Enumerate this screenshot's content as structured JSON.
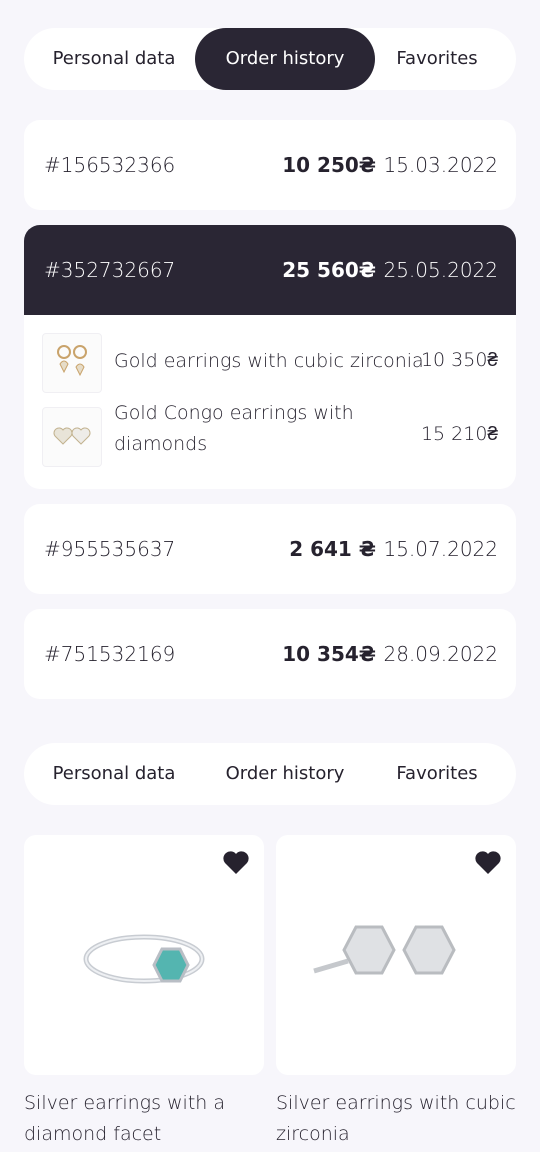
{
  "tabs_top": {
    "personal": "Personal data",
    "orders": "Order history",
    "favorites": "Favorites",
    "active": "orders"
  },
  "orders": [
    {
      "number": "#156532366",
      "sum": "10 250₴",
      "date": "15.03.2022"
    },
    {
      "number": "#352732667",
      "sum": "25 560₴",
      "date": "25.05.2022",
      "expanded": true,
      "items": [
        {
          "name": "Gold earrings with cubic zirconia",
          "price": "10 350₴"
        },
        {
          "name_line1": "Gold Congo earrings with",
          "name_line2": "diamonds",
          "price": "15 210₴"
        }
      ]
    },
    {
      "number": "#955535637",
      "sum": "2 641 ₴",
      "date": "15.07.2022"
    },
    {
      "number": "#751532169",
      "sum": "10 354₴",
      "date": "28.09.2022"
    }
  ],
  "tabs_bottom": {
    "personal": "Personal data",
    "orders": "Order history",
    "favorites": "Favorites"
  },
  "favorites": [
    {
      "name_line1": "Silver earrings with a",
      "name_line2": "diamond facet",
      "icon": "heart-icon"
    },
    {
      "name_line1": "Silver earrings with cubic",
      "name_line2": "zirconia",
      "icon": "heart-icon"
    }
  ],
  "colors": {
    "dark": "#2a2634",
    "bg": "#f7f6fb",
    "card": "#ffffff"
  }
}
